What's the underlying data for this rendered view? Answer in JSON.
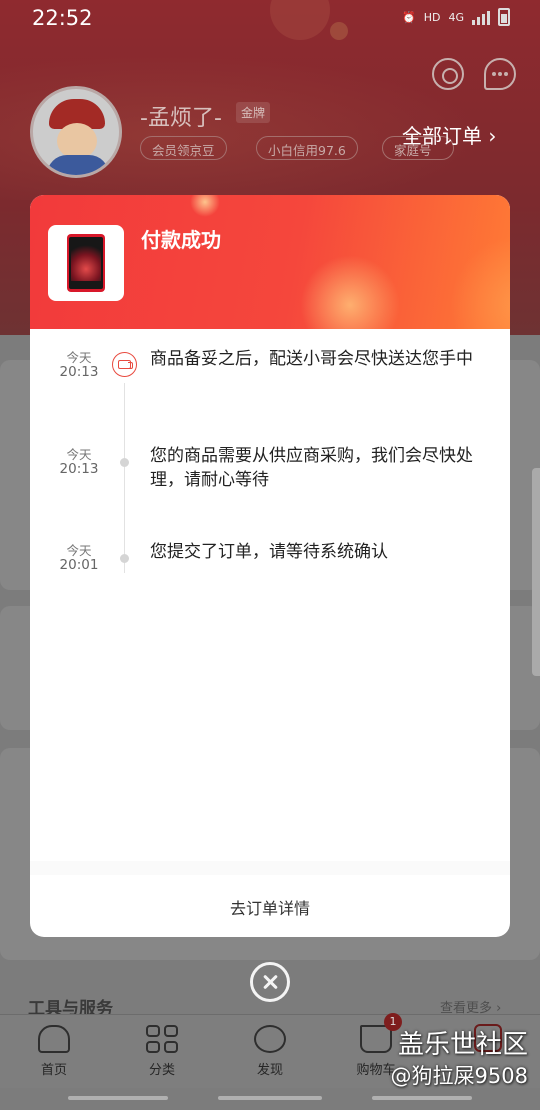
{
  "status_bar": {
    "time": "22:52",
    "hd": "HD",
    "net": "4G"
  },
  "profile": {
    "username": "-孟烦了-",
    "tier": "金牌",
    "pills": [
      "会员领京豆",
      "小白信用97.6",
      "家庭号"
    ],
    "all_orders": "全部订单 ›"
  },
  "background": {
    "tools_title": "工具与服务",
    "see_more": "查看更多 ›",
    "tabs": [
      "首页",
      "分类",
      "发现",
      "购物车"
    ],
    "cart_count": "1"
  },
  "modal": {
    "title": "付款成功",
    "timeline": [
      {
        "day": "今天",
        "time": "20:13",
        "text": "商品备妥之后，配送小哥会尽快送达您手中",
        "icon": "truck-icon"
      },
      {
        "day": "今天",
        "time": "20:13",
        "text": "您的商品需要从供应商采购，我们会尽快处理，请耐心等待",
        "icon": "dot"
      },
      {
        "day": "今天",
        "time": "20:01",
        "text": "您提交了订单，请等待系统确认",
        "icon": "dot"
      }
    ],
    "detail_link": "去订单详情"
  },
  "watermark": {
    "line1": "盖乐世社区",
    "line2": "@狗拉屎9508"
  },
  "colors": {
    "header_red": "#f23a3b",
    "header_orange": "#ff7b35",
    "overlay_gray": "#7c7c7c"
  }
}
